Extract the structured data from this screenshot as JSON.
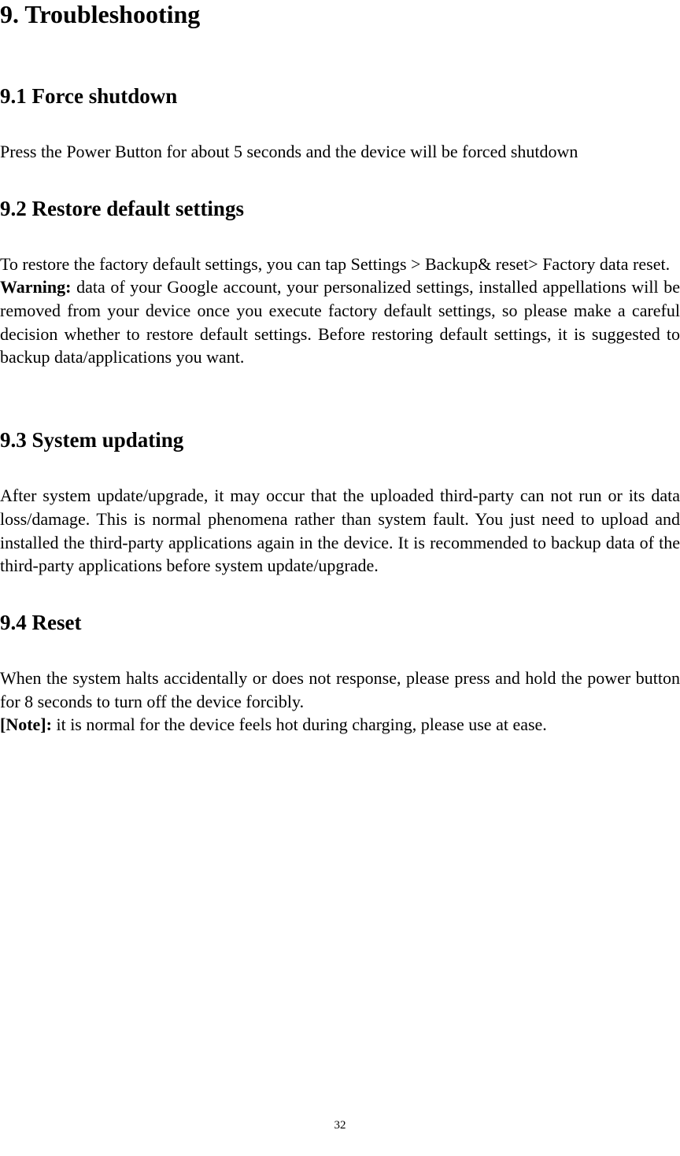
{
  "h1": "9. Troubleshooting",
  "s91": {
    "heading": "9.1 Force shutdown",
    "body": "Press the Power Button for about 5 seconds and the device will be forced shutdown"
  },
  "s92": {
    "heading": "9.2 Restore default settings",
    "intro": "To restore the factory default settings, you can tap Settings > Backup& reset> Factory data reset.",
    "warning_label": "Warning:",
    "warning_body": " data of your Google account, your personalized settings, installed appellations will be removed from your device once you execute factory default settings, so please make a careful decision whether to restore default settings. Before restoring default settings, it is suggested to backup data/applications you want."
  },
  "s93": {
    "heading": "9.3 System updating",
    "body": "After system update/upgrade, it may occur that the uploaded third-party can not run or its data loss/damage. This is normal phenomena rather than system fault. You just need to upload and installed the third-party applications again in the device. It is recommended to backup data of the third-party applications before system update/upgrade."
  },
  "s94": {
    "heading": "9.4 Reset",
    "body1": "When the system halts accidentally or does not response, please press and hold the power button for 8 seconds to turn off the device forcibly.",
    "note_label": "[Note]:",
    "note_body": " it is normal for the device feels hot during charging, please use at ease."
  },
  "page_number": "32"
}
